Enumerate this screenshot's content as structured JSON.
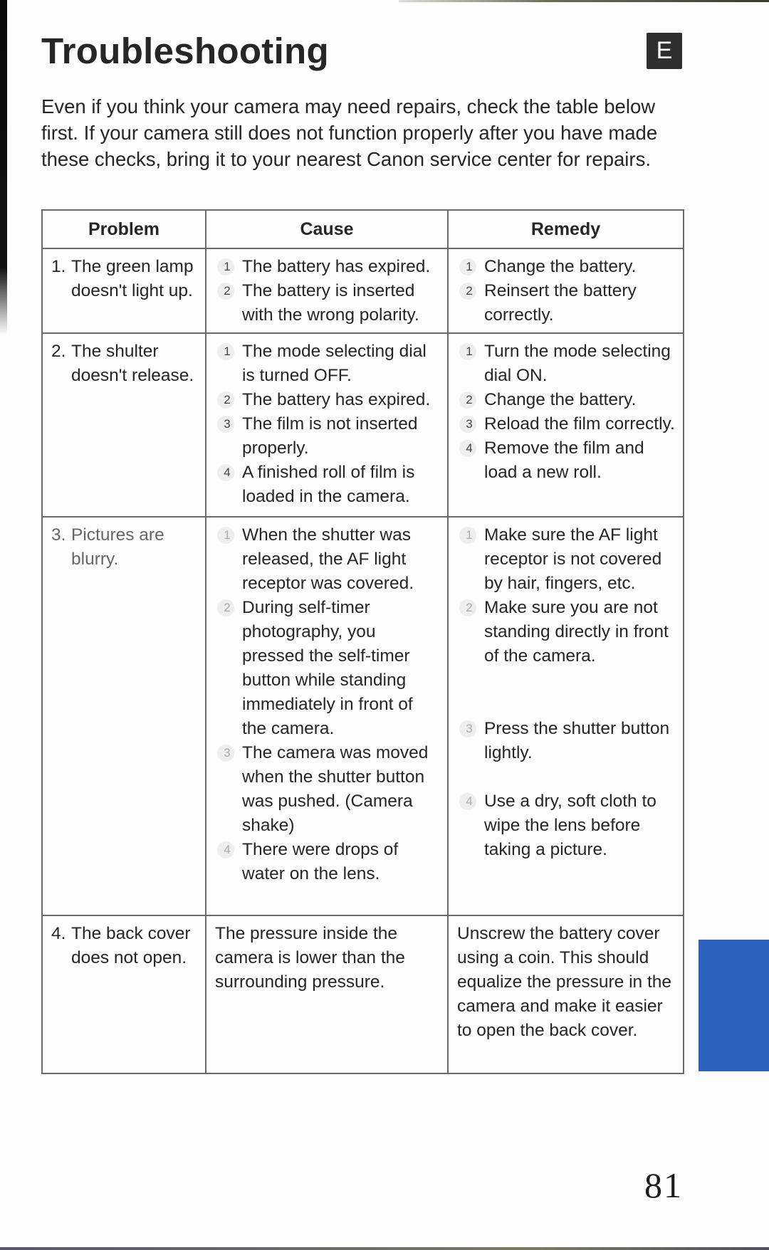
{
  "page": {
    "title": "Troubleshooting",
    "language_badge": "E",
    "intro": "Even if you think your camera may need repairs, check the table below first. If your camera still does not function properly after you have made these checks, bring it to your nearest Canon service center for repairs.",
    "page_number": "81",
    "section_tab_color": "#2c62bd"
  },
  "table": {
    "headers": [
      "Problem",
      "Cause",
      "Remedy"
    ],
    "rows": [
      {
        "problem_num": "1.",
        "problem": "The green lamp doesn't light up.",
        "causes": [
          {
            "n": "1",
            "text": "The battery has expired."
          },
          {
            "n": "2",
            "text": "The battery is inserted with the wrong polarity."
          }
        ],
        "remedies": [
          {
            "n": "1",
            "text": "Change the battery."
          },
          {
            "n": "2",
            "text": "Reinsert the battery correctly."
          }
        ]
      },
      {
        "problem_num": "2.",
        "problem": "The shulter doesn't release.",
        "causes": [
          {
            "n": "1",
            "text": "The mode selecting dial is turned OFF."
          },
          {
            "n": "2",
            "text": "The battery has expired."
          },
          {
            "n": "3",
            "text": "The film is not inserted properly."
          },
          {
            "n": "4",
            "text": "A finished roll of film is loaded in the camera."
          }
        ],
        "remedies": [
          {
            "n": "1",
            "text": "Turn the mode selecting dial ON."
          },
          {
            "n": "2",
            "text": "Change the battery."
          },
          {
            "n": "3",
            "text": "Reload the film correctly."
          },
          {
            "n": "4",
            "text": "Remove the film and load a new roll."
          }
        ]
      },
      {
        "problem_num": "3.",
        "problem": "Pictures are blurry.",
        "causes": [
          {
            "n": "1",
            "text": "When the shutter was released, the AF light receptor was covered."
          },
          {
            "n": "2",
            "text": "During self-timer photography, you pressed the self-timer button while standing immediately in front of the camera."
          },
          {
            "n": "3",
            "text": "The camera was moved when the shutter button was pushed. (Camera shake)"
          },
          {
            "n": "4",
            "text": "There were drops of water on the lens."
          }
        ],
        "remedies": [
          {
            "n": "1",
            "text": "Make sure the AF light receptor is not covered by hair, fingers, etc."
          },
          {
            "n": "2",
            "text": "Make sure you are not standing directly in front of the camera."
          },
          {
            "n": "3",
            "text": "Press the shutter button lightly."
          },
          {
            "n": "4",
            "text": "Use a dry, soft cloth to wipe the lens before taking a picture."
          }
        ]
      },
      {
        "problem_num": "4.",
        "problem": "The back cover does not open.",
        "cause": "The pressure inside the camera is lower than the surrounding pressure.",
        "remedy": "Unscrew the battery cover using a coin. This should equalize the pressure in the camera and make it easier to open the back cover."
      }
    ]
  }
}
